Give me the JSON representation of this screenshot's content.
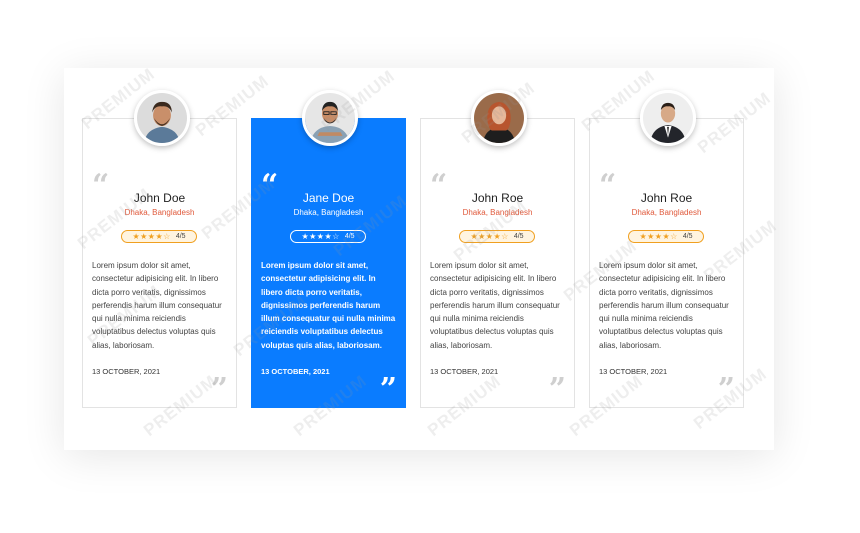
{
  "watermark_text": "PREMIUM",
  "colors": {
    "accent": "#0a7cff",
    "location": "#e05a3c",
    "star": "#f0a020"
  },
  "testimonials": [
    {
      "name": "John Doe",
      "location": "Dhaka, Bangladesh",
      "stars": "★★★★☆",
      "rating": "4/5",
      "text": "Lorem ipsum dolor sit amet, consectetur adipisicing elit. In libero dicta porro veritatis, dignissimos perferendis harum illum consequatur qui nulla minima reiciendis voluptatibus delectus voluptas quis alias, laboriosam.",
      "date": "13 OCTOBER, 2021",
      "featured": false
    },
    {
      "name": "Jane Doe",
      "location": "Dhaka, Bangladesh",
      "stars": "★★★★☆",
      "rating": "4/5",
      "text": "Lorem ipsum dolor sit amet, consectetur adipisicing elit. In libero dicta porro veritatis, dignissimos perferendis harum illum consequatur qui nulla minima reiciendis voluptatibus delectus voluptas quis alias, laboriosam.",
      "date": "13 OCTOBER, 2021",
      "featured": true
    },
    {
      "name": "John Roe",
      "location": "Dhaka, Bangladesh",
      "stars": "★★★★☆",
      "rating": "4/5",
      "text": "Lorem ipsum dolor sit amet, consectetur adipisicing elit. In libero dicta porro veritatis, dignissimos perferendis harum illum consequatur qui nulla minima reiciendis voluptatibus delectus voluptas quis alias, laboriosam.",
      "date": "13 OCTOBER, 2021",
      "featured": false
    },
    {
      "name": "John Roe",
      "location": "Dhaka, Bangladesh",
      "stars": "★★★★☆",
      "rating": "4/5",
      "text": "Lorem ipsum dolor sit amet, consectetur adipisicing elit. In libero dicta porro veritatis, dignissimos perferendis harum illum consequatur qui nulla minima reiciendis voluptatibus delectus voluptas quis alias, laboriosam.",
      "date": "13 OCTOBER, 2021",
      "featured": false
    }
  ]
}
